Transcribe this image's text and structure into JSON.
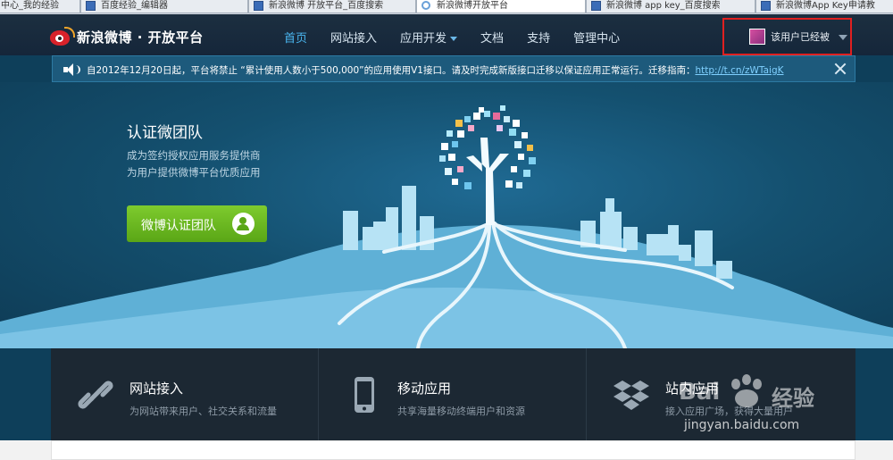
{
  "browser": {
    "tabs": [
      {
        "label": "中心_我的经验",
        "active": false
      },
      {
        "label": "百度经验_编辑器",
        "active": false
      },
      {
        "label": "新浪微博 开放平台_百度搜索",
        "active": false
      },
      {
        "label": "新浪微博开放平台",
        "active": true
      },
      {
        "label": "新浪微博 app key_百度搜索",
        "active": false
      },
      {
        "label": "新浪微博App Key申请教",
        "active": false
      }
    ]
  },
  "header": {
    "logo_text": "新浪微博 · 开放平台",
    "nav": [
      {
        "label": "首页",
        "active": true
      },
      {
        "label": "网站接入",
        "active": false
      },
      {
        "label": "应用开发",
        "active": false,
        "dropdown": true
      },
      {
        "label": "文档",
        "active": false
      },
      {
        "label": "支持",
        "active": false
      },
      {
        "label": "管理中心",
        "active": false
      }
    ],
    "user": {
      "name": "该用户已经被"
    }
  },
  "notice": {
    "text": "自2012年12月20日起，平台将禁止 “累计使用人数小于500,000”的应用使用V1接口。请及时完成新版接口迁移以保证应用正常运行。迁移指南：",
    "link": "http://t.cn/zWTaigK"
  },
  "hero": {
    "title": "认证微团队",
    "subtitle1": "成为签约授权应用服务提供商",
    "subtitle2": "为用户提供微博平台优质应用",
    "button_label": "微博认证团队"
  },
  "features": [
    {
      "title": "网站接入",
      "desc": "为网站带来用户、社交关系和流量",
      "icon": "link-icon"
    },
    {
      "title": "移动应用",
      "desc": "共享海量移动终端用户和资源",
      "icon": "mobile-icon"
    },
    {
      "title": "站内应用",
      "desc": "接入应用广场，获得大量用户",
      "icon": "dropbox-icon"
    }
  ],
  "watermark": {
    "brand": "Bai",
    "brand2": "经验",
    "url": "jingyan.baidu.com"
  },
  "colors": {
    "nav_active": "#4ab6f0",
    "button_green": "#6dbb25",
    "highlight_red": "#e02020"
  }
}
